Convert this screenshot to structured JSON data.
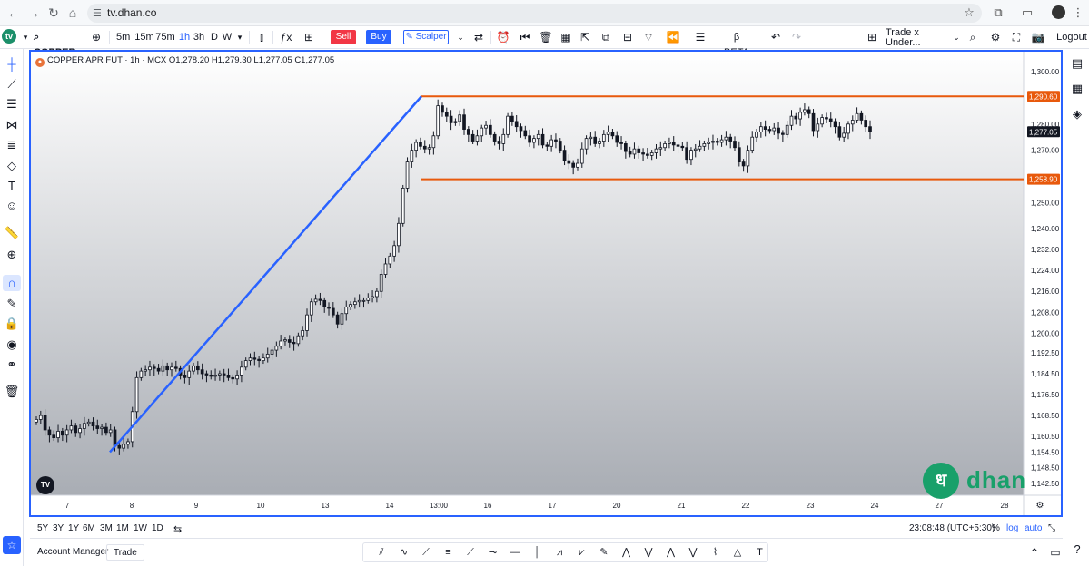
{
  "browser": {
    "url": "tv.dhan.co",
    "back_glyph": "←",
    "forward_glyph": "→",
    "reload_glyph": "↻",
    "home_glyph": "⌂",
    "star_glyph": "☆",
    "extensions_glyph": "⧉",
    "cast_glyph": "▭",
    "menu_glyph": "⋮"
  },
  "toolbar": {
    "symbol": "COPPER A",
    "intervals": [
      "5m",
      "15m",
      "75m",
      "1h",
      "3h",
      "D",
      "W"
    ],
    "active_interval": "1h",
    "sell_label": "Sell",
    "buy_label": "Buy",
    "scalper_label": "Scalper",
    "beta_label": "BETA",
    "layout_name": "Trade x Under...",
    "layout_status": "Save",
    "logout_label": "Logout"
  },
  "legend": {
    "text": "COPPER APR FUT · 1h · MCX",
    "open": "O1,278.20",
    "high": "H1,279.30",
    "low": "L1,277.05",
    "close": "C1,277.05"
  },
  "colors": {
    "accent": "#2962ff",
    "sell": "#f23645",
    "level_line": "#e8590c",
    "trend_line": "#2962ff",
    "brand": "#19a06a"
  },
  "chart_data": {
    "type": "candlestick",
    "title": "COPPER APR FUT · 1h · MCX",
    "price_axis": {
      "ylim": [
        1138,
        1307
      ],
      "ticks": [
        "1,300.00",
        "1,290.60",
        "1,280.00",
        "1,277.05",
        "1,270.00",
        "1,258.90",
        "1,250.00",
        "1,240.00",
        "1,232.00",
        "1,224.00",
        "1,216.00",
        "1,208.00",
        "1,200.00",
        "1,192.50",
        "1,184.50",
        "1,176.50",
        "1,168.50",
        "1,160.50",
        "1,154.50",
        "1,148.50",
        "1,142.50"
      ],
      "labels_plain": [
        "1,300.00",
        "1,280.00",
        "1,270.00",
        "1,250.00",
        "1,240.00",
        "1,232.00",
        "1,224.00",
        "1,216.00",
        "1,208.00",
        "1,200.00",
        "1,192.50",
        "1,184.50",
        "1,176.50",
        "1,168.50",
        "1,160.50",
        "1,154.50",
        "1,148.50",
        "1,142.50"
      ]
    },
    "time_axis": {
      "labels": [
        "7",
        "8",
        "9",
        "10",
        "13",
        "14",
        "13:00",
        "16",
        "17",
        "20",
        "21",
        "22",
        "23",
        "24",
        "27",
        "28"
      ]
    },
    "horizontal_levels": [
      {
        "price": 1290.6,
        "label": "1,290.60"
      },
      {
        "price": 1258.9,
        "label": "1,258.90"
      }
    ],
    "last_price": {
      "price": 1277.05,
      "label": "1,277.05"
    },
    "trend_line": {
      "from_price": 1154.5,
      "to_price": 1290.6
    },
    "closes": [
      1167.0,
      1168.5,
      1163.0,
      1161.0,
      1160.0,
      1162.5,
      1161.0,
      1163.0,
      1164.5,
      1162.0,
      1163.5,
      1165.5,
      1166.0,
      1164.5,
      1163.5,
      1164.0,
      1162.0,
      1163.0,
      1157.0,
      1156.0,
      1157.5,
      1158.5,
      1170.0,
      1183.0,
      1185.5,
      1186.0,
      1187.0,
      1186.5,
      1185.5,
      1187.5,
      1186.0,
      1187.0,
      1186.5,
      1184.0,
      1183.0,
      1185.5,
      1187.5,
      1186.0,
      1184.5,
      1184.0,
      1183.5,
      1184.0,
      1184.5,
      1184.0,
      1183.0,
      1182.5,
      1184.0,
      1187.0,
      1189.5,
      1190.5,
      1190.0,
      1189.5,
      1190.5,
      1192.0,
      1193.5,
      1195.0,
      1197.0,
      1197.5,
      1196.5,
      1196.0,
      1199.0,
      1201.0,
      1207.0,
      1212.0,
      1213.0,
      1212.5,
      1210.0,
      1209.5,
      1207.0,
      1203.5,
      1207.5,
      1210.0,
      1211.0,
      1212.0,
      1212.5,
      1212.5,
      1213.5,
      1214.0,
      1216.0,
      1222.5,
      1226.5,
      1229.5,
      1233.5,
      1242.0,
      1255.5,
      1265.5,
      1270.0,
      1273.0,
      1271.5,
      1270.5,
      1271.0,
      1275.5,
      1287.0,
      1284.5,
      1283.0,
      1280.5,
      1281.0,
      1283.5,
      1278.0,
      1276.0,
      1273.5,
      1275.5,
      1278.5,
      1279.5,
      1276.0,
      1273.5,
      1272.5,
      1276.0,
      1283.0,
      1281.0,
      1279.0,
      1277.5,
      1275.5,
      1273.0,
      1274.5,
      1276.0,
      1272.0,
      1271.5,
      1274.0,
      1273.5,
      1270.0,
      1266.0,
      1265.0,
      1263.5,
      1265.0,
      1270.5,
      1274.5,
      1275.0,
      1272.5,
      1273.5,
      1276.0,
      1277.0,
      1275.5,
      1273.0,
      1272.5,
      1269.5,
      1268.5,
      1270.5,
      1269.0,
      1268.5,
      1268.0,
      1269.0,
      1270.5,
      1271.0,
      1272.5,
      1273.0,
      1272.0,
      1271.5,
      1271.0,
      1266.5,
      1270.0,
      1270.5,
      1271.5,
      1272.5,
      1273.0,
      1273.5,
      1273.0,
      1274.0,
      1275.0,
      1273.5,
      1271.0,
      1265.5,
      1264.0,
      1270.0,
      1275.0,
      1277.0,
      1279.0,
      1278.0,
      1277.5,
      1278.5,
      1276.5,
      1276.0,
      1279.5,
      1283.0,
      1282.0,
      1284.5,
      1285.5,
      1284.0,
      1277.5,
      1280.0,
      1282.5,
      1282.0,
      1281.0,
      1279.0,
      1275.0,
      1276.5,
      1280.0,
      1281.5,
      1284.0,
      1281.5,
      1279.0,
      1277.05
    ]
  },
  "range_bar": {
    "ranges": [
      "5Y",
      "3Y",
      "1Y",
      "6M",
      "3M",
      "1M",
      "1W",
      "1D"
    ],
    "clock": "23:08:48 (UTC+5:30)",
    "pct_label": "%",
    "log_label": "log",
    "auto_label": "auto"
  },
  "bottom": {
    "account_manager_label": "Account Manager",
    "trade_label": "Trade",
    "dock_text_tool": "T"
  },
  "brand": {
    "logo_glyph": "ध",
    "name": "dhan",
    "tv_badge": "TV"
  }
}
